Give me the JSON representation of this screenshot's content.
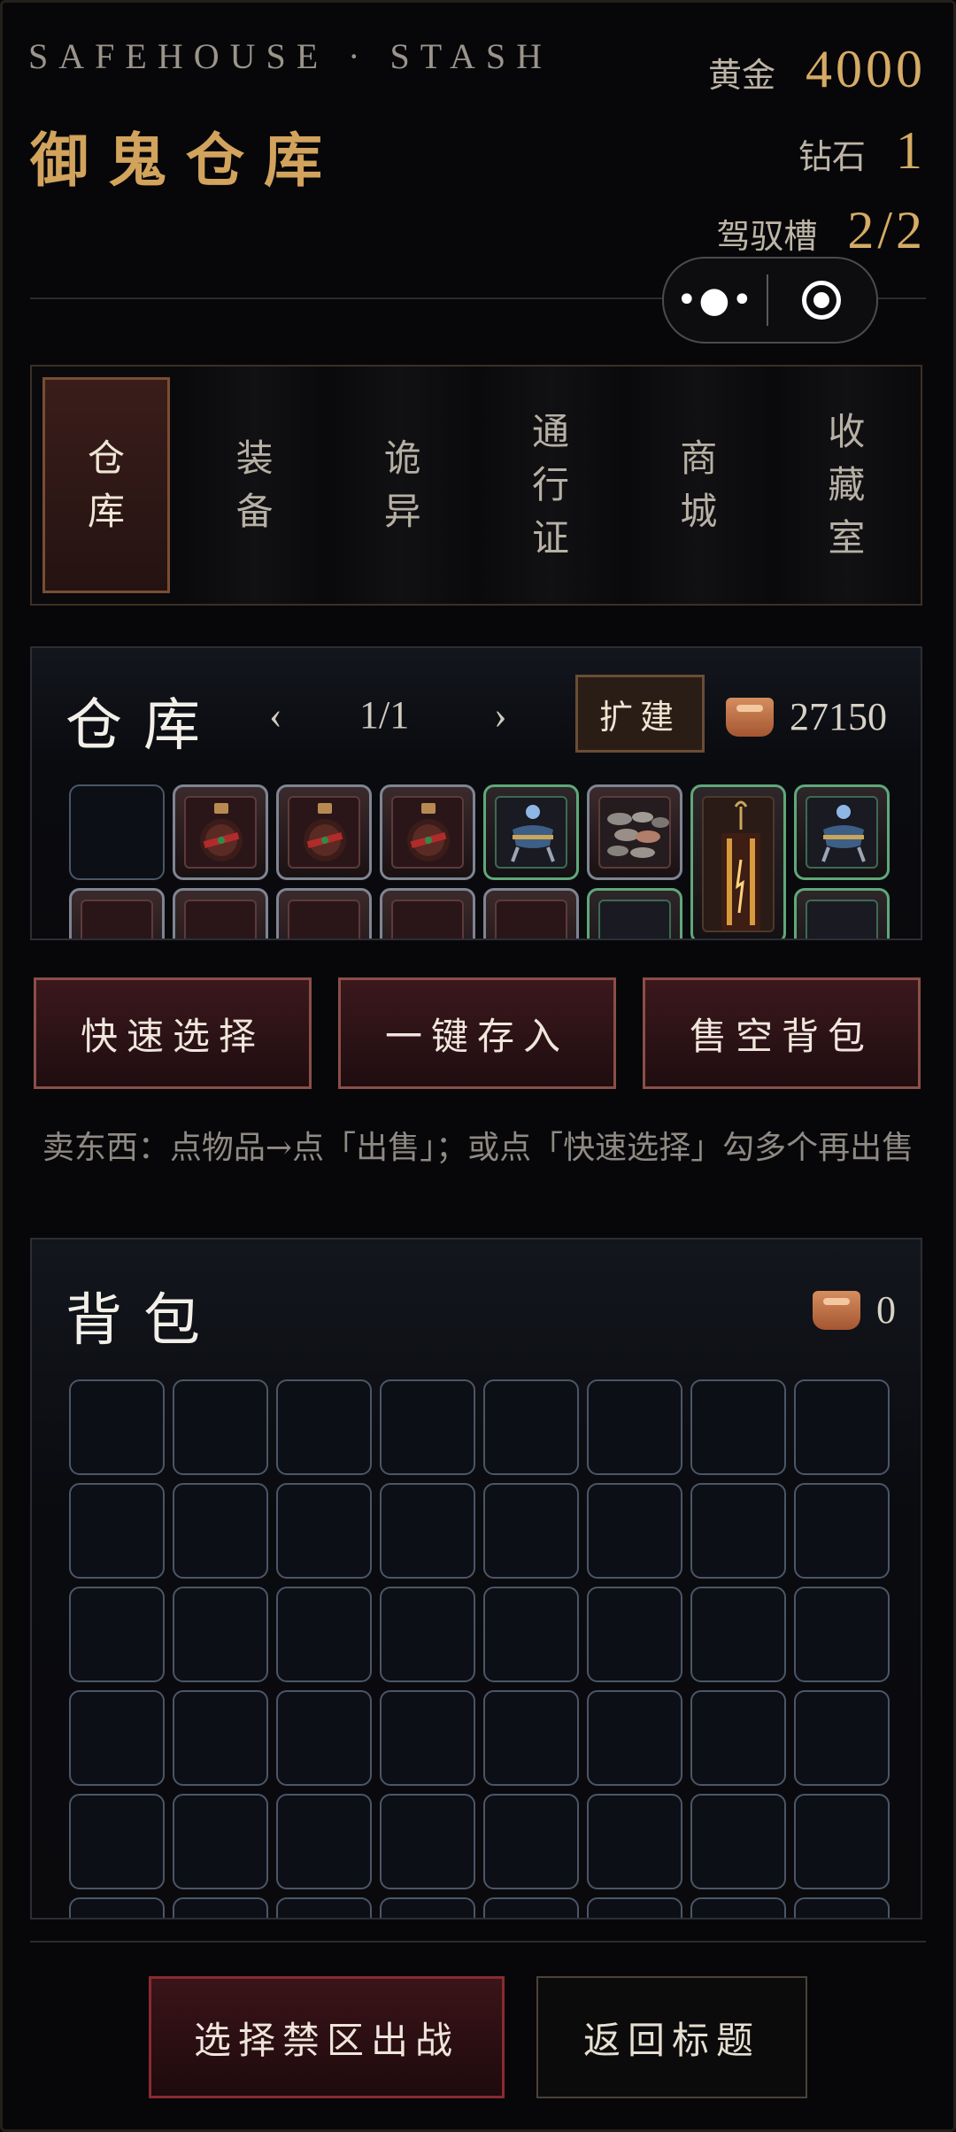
{
  "header": {
    "subtitle": "SAFEHOUSE · STASH",
    "title": "御鬼仓库",
    "gold_label": "黄金",
    "gold_value": "4000",
    "diamond_label": "钻石",
    "diamond_value": "1",
    "slot_label": "驾驭槽",
    "slot_value": "2/2"
  },
  "capsule": {
    "more_icon": "more-dots-icon",
    "close_icon": "target-circle-icon"
  },
  "tabs": [
    {
      "label": "仓库",
      "active": true
    },
    {
      "label": "装备",
      "active": false
    },
    {
      "label": "诡异",
      "active": false
    },
    {
      "label": "通行证",
      "active": false
    },
    {
      "label": "商城",
      "active": false
    },
    {
      "label": "收藏室",
      "active": false
    }
  ],
  "warehouse": {
    "title": "仓库",
    "prev": "‹",
    "page": "1/1",
    "next": "›",
    "expand_label": "扩建",
    "coin_icon": "copper-coin-icon",
    "coin_value": "27150",
    "row1": [
      {
        "type": "empty"
      },
      {
        "type": "item",
        "border": "gray",
        "icon": "potion-jar-icon"
      },
      {
        "type": "item",
        "border": "gray",
        "icon": "potion-jar-icon"
      },
      {
        "type": "item",
        "border": "gray",
        "icon": "potion-jar-icon"
      },
      {
        "type": "item",
        "border": "green",
        "icon": "incense-burner-icon"
      },
      {
        "type": "item",
        "border": "gray",
        "icon": "stone-pile-icon"
      },
      {
        "type": "item",
        "border": "green",
        "icon": "lantern-icon"
      },
      {
        "type": "item",
        "border": "green",
        "icon": "incense-burner-icon"
      }
    ],
    "row2": [
      {
        "border": "gray"
      },
      {
        "border": "gray"
      },
      {
        "border": "gray"
      },
      {
        "border": "gray"
      },
      {
        "border": "gray"
      },
      {
        "border": "green"
      },
      {
        "border": "green"
      },
      {
        "border": "green"
      }
    ]
  },
  "actions": {
    "quick_select": "快速选择",
    "store_all": "一键存入",
    "sell_bag": "售空背包"
  },
  "hint": "卖东西：点物品→点「出售」；或点「快速选择」勾多个再出售",
  "backpack": {
    "title": "背包",
    "coin_icon": "copper-coin-icon",
    "coin_value": "0"
  },
  "footer": {
    "deploy": "选择禁区出战",
    "back": "返回标题"
  },
  "colors": {
    "gold": "#d6ab64",
    "accent_red": "#7a2026",
    "green_border": "#5fa87a"
  }
}
